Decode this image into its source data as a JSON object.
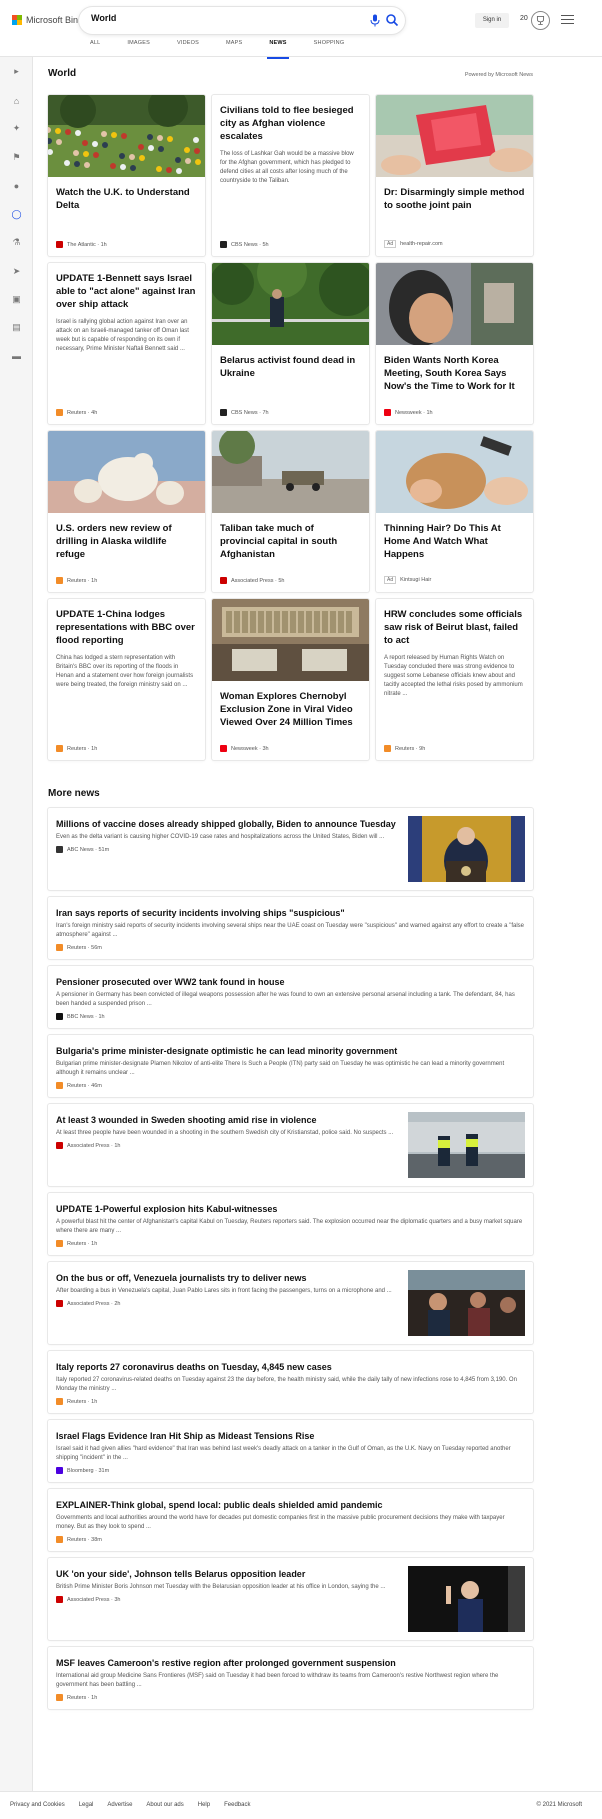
{
  "header": {
    "logo_text": "Microsoft Bing",
    "search_value": "World",
    "signin_label": "Sign in",
    "rewards_count": "20",
    "tabs": [
      {
        "label": "ALL"
      },
      {
        "label": "IMAGES"
      },
      {
        "label": "VIDEOS"
      },
      {
        "label": "MAPS"
      },
      {
        "label": "NEWS"
      },
      {
        "label": "SHOPPING"
      }
    ],
    "active_tab": "NEWS"
  },
  "rail": {
    "icons": [
      "chevron-right-icon",
      "home-icon",
      "tools-icon",
      "flag-icon",
      "location-icon",
      "globe-icon",
      "microscope-icon",
      "rocket-icon",
      "film-icon",
      "bank-icon",
      "card-icon"
    ]
  },
  "world": {
    "title": "World",
    "powered_by": "Powered by Microsoft News",
    "cards": [
      {
        "title": "Watch the U.K. to Understand Delta",
        "desc": "",
        "source": "The Atlantic",
        "time": "1h",
        "image": "crowd-park",
        "src_color": "#c00"
      },
      {
        "title": "Civilians told to flee besieged city as Afghan violence escalates",
        "desc": "The loss of Lashkar Gah would be a massive blow for the Afghan government, which has pledged to defend cities at all costs after losing much of the countryside to the Taliban.",
        "source": "CBS News",
        "time": "5h",
        "image": "",
        "src_color": "#222"
      },
      {
        "title": "Dr: Disarmingly simple method to soothe joint pain",
        "desc": "",
        "source": "health-repair.com",
        "time": "",
        "ad": "Ad",
        "image": "red-jelly",
        "src_color": ""
      },
      {
        "title": "UPDATE 1-Bennett says Israel able to \"act alone\" against Iran over ship attack",
        "desc": "Israel is rallying global action against Iran over an attack on an Israeli-managed tanker off Oman last week but is capable of responding on its own if necessary, Prime Minister Naftali Bennett said ...",
        "source": "Reuters",
        "time": "4h",
        "image": "",
        "src_color": "#f28c28"
      },
      {
        "title": "Belarus activist found dead in Ukraine",
        "desc": "",
        "source": "CBS News",
        "time": "7h",
        "image": "forest-police",
        "src_color": "#222"
      },
      {
        "title": "Biden Wants North Korea Meeting, South Korea Says Now's the Time to Work for It",
        "desc": "",
        "source": "Newsweek",
        "time": "1h",
        "image": "portrait-photo",
        "src_color": "#e01"
      },
      {
        "title": "U.S. orders new review of drilling in Alaska wildlife refuge",
        "desc": "",
        "source": "Reuters",
        "time": "1h",
        "image": "polar-bears",
        "src_color": "#f28c28"
      },
      {
        "title": "Taliban take much of provincial capital in south Afghanistan",
        "desc": "",
        "source": "Associated Press",
        "time": "5h",
        "image": "street-truck",
        "src_color": "#c00"
      },
      {
        "title": "Thinning Hair? Do This At Home And Watch What Happens",
        "desc": "",
        "source": "Kintsugi Hair",
        "time": "",
        "ad": "Ad",
        "image": "hair-treatment",
        "src_color": ""
      },
      {
        "title": "UPDATE 1-China lodges representations with BBC over flood reporting",
        "desc": "China has lodged a stern representation with Britain's BBC over its reporting of the floods in Henan and a statement over how foreign journalists were being treated, the foreign ministry said on ...",
        "source": "Reuters",
        "time": "1h",
        "image": "",
        "src_color": "#f28c28"
      },
      {
        "title": "Woman Explores Chernobyl Exclusion Zone in Viral Video Viewed Over 24 Million Times",
        "desc": "",
        "source": "Newsweek",
        "time": "3h",
        "image": "control-room",
        "src_color": "#e01"
      },
      {
        "title": "HRW concludes some officials saw risk of Beirut blast, failed to act",
        "desc": "A report released by Human Rights Watch on Tuesday concluded there was strong evidence to suggest some Lebanese officials knew about and tacitly accepted the lethal risks posed by ammonium nitrate ...",
        "source": "Reuters",
        "time": "9h",
        "image": "",
        "src_color": "#f28c28"
      }
    ]
  },
  "more_news": {
    "title": "More news",
    "items": [
      {
        "title": "Millions of vaccine doses already shipped globally, Biden to announce Tuesday",
        "desc": "Even as the delta variant is causing higher COVID-19 case rates and hospitalizations across the United States, Biden will ...",
        "source": "ABC News",
        "time": "51m",
        "image": "biden-podium",
        "src_color": "#333"
      },
      {
        "title": "Iran says reports of security incidents involving ships \"suspicious\"",
        "desc": "Iran's foreign ministry said reports of security incidents involving several ships near the UAE coast on Tuesday were \"suspicious\" and warned against any effort to create a \"false atmosphere\" against ...",
        "source": "Reuters",
        "time": "56m",
        "image": "",
        "src_color": "#f28c28"
      },
      {
        "title": "Pensioner prosecuted over WW2 tank found in house",
        "desc": "A pensioner in Germany has been convicted of illegal weapons possession after he was found to own an extensive personal arsenal including a tank. The defendant, 84, has been handed a suspended prison ...",
        "source": "BBC News",
        "time": "1h",
        "image": "",
        "src_color": "#111"
      },
      {
        "title": "Bulgaria's prime minister-designate optimistic he can lead minority government",
        "desc": "Bulgarian prime minister-designate Plamen Nikolov of anti-elite There Is Such a People (ITN) party said on Tuesday he was optimistic he can lead a minority government although it remains unclear ...",
        "source": "Reuters",
        "time": "46m",
        "image": "",
        "src_color": "#f28c28"
      },
      {
        "title": "At least 3 wounded in Sweden shooting amid rise in violence",
        "desc": "At least three people have been wounded in a shooting in the southern Swedish city of Kristianstad, police said. No suspects ...",
        "source": "Associated Press",
        "time": "1h",
        "image": "police-street",
        "src_color": "#c00"
      },
      {
        "title": "UPDATE 1-Powerful explosion hits Kabul-witnesses",
        "desc": "A powerful blast hit the center of Afghanistan's capital Kabul on Tuesday, Reuters reporters said. The explosion occurred near the diplomatic quarters and a busy market square where there are many ...",
        "source": "Reuters",
        "time": "1h",
        "image": "",
        "src_color": "#f28c28"
      },
      {
        "title": "On the bus or off, Venezuela journalists try to deliver news",
        "desc": "After boarding a bus in Venezuela's capital, Juan Pablo Lares sits in front facing the passengers, turns on a microphone and ...",
        "source": "Associated Press",
        "time": "2h",
        "image": "bus-interior",
        "src_color": "#c00"
      },
      {
        "title": "Italy reports 27 coronavirus deaths on Tuesday, 4,845 new cases",
        "desc": "Italy reported 27 coronavirus-related deaths on Tuesday against 23 the day before, the health ministry said, while the daily tally of new infections rose to 4,845 from 3,190. On Monday the ministry ...",
        "source": "Reuters",
        "time": "1h",
        "image": "",
        "src_color": "#f28c28"
      },
      {
        "title": "Israel Flags Evidence Iran Hit Ship as Mideast Tensions Rise",
        "desc": "Israel said it had given allies \"hard evidence\" that Iran was behind last week's deadly attack on a tanker in the Gulf of Oman, as the U.K. Navy on Tuesday reported another shipping \"incident\" in the ...",
        "source": "Bloomberg",
        "time": "31m",
        "image": "",
        "src_color": "#4b00e0"
      },
      {
        "title": "EXPLAINER-Think global, spend local: public deals shielded amid pandemic",
        "desc": "Governments and local authorities around the world have for decades put domestic companies first in the massive public procurement decisions they make with taxpayer money. But as they look to spend ...",
        "source": "Reuters",
        "time": "38m",
        "image": "",
        "src_color": "#f28c28"
      },
      {
        "title": "UK 'on your side', Johnson tells Belarus opposition leader",
        "desc": "British Prime Minister Boris Johnson met Tuesday with the Belarusian opposition leader at his office in London, saying the ...",
        "source": "Associated Press",
        "time": "3h",
        "image": "woman-waving",
        "src_color": "#c00"
      },
      {
        "title": "MSF leaves Cameroon's restive region after prolonged government suspension",
        "desc": "International aid group Medicine Sans Frontieres (MSF) said on Tuesday it had been forced to withdraw its teams from Cameroon's restive Northwest region where the government has been battling ...",
        "source": "Reuters",
        "time": "1h",
        "image": "",
        "src_color": "#f28c28"
      }
    ]
  },
  "footer": {
    "links": [
      "Privacy and Cookies",
      "Legal",
      "Advertise",
      "About our ads",
      "Help",
      "Feedback"
    ],
    "copyright": "© 2021 Microsoft"
  }
}
